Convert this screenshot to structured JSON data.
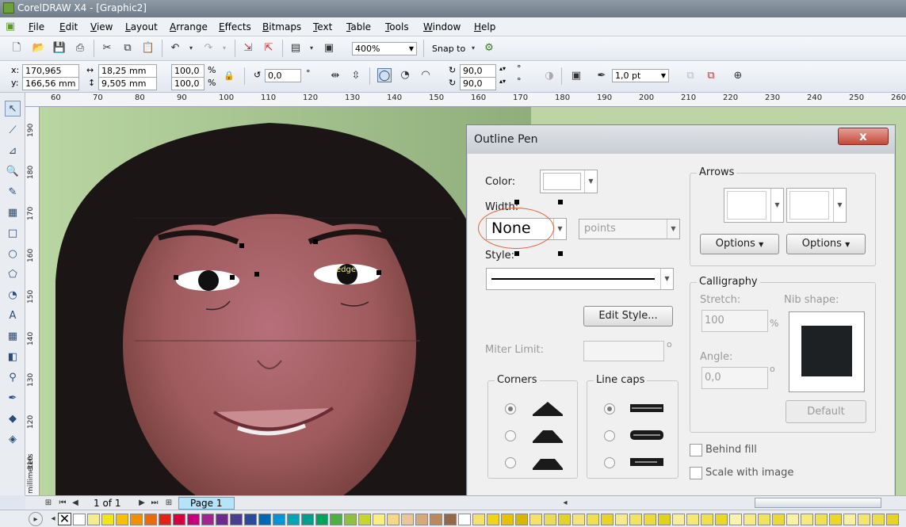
{
  "window": {
    "title": "CorelDRAW X4 - [Graphic2]"
  },
  "menu": [
    {
      "label": "File",
      "key": "F",
      "rest": "ile"
    },
    {
      "label": "Edit",
      "key": "E",
      "rest": "dit"
    },
    {
      "label": "View",
      "key": "V",
      "rest": "iew"
    },
    {
      "label": "Layout",
      "key": "L",
      "rest": "ayout"
    },
    {
      "label": "Arrange",
      "key": "A",
      "rest": "rrange"
    },
    {
      "label": "Effects",
      "key": "E",
      "rest": "ffects"
    },
    {
      "label": "Bitmaps",
      "key": "B",
      "rest": "itmaps"
    },
    {
      "label": "Text",
      "key": "T",
      "rest": "ext"
    },
    {
      "label": "Table",
      "key": "T",
      "rest": "able"
    },
    {
      "label": "Tools",
      "key": "T",
      "rest": "ools"
    },
    {
      "label": "Window",
      "key": "W",
      "rest": "indow"
    },
    {
      "label": "Help",
      "key": "H",
      "rest": "elp"
    }
  ],
  "toolbar": {
    "zoom": "400%",
    "snap_to": "Snap to"
  },
  "property_bar": {
    "x_label": "x:",
    "x": "170,965 mm",
    "y_label": "y:",
    "y": "166,56 mm",
    "width": "18,25 mm",
    "height": "9,505 mm",
    "scale_x": "100,0",
    "scale_y": "100,0",
    "percent": "%",
    "rotation": "0,0",
    "degree": "°",
    "skew_x": "90,0",
    "skew_y": "90,0",
    "outline_width": "1,0 pt"
  },
  "ruler": {
    "h_ticks": [
      "60",
      "70",
      "80",
      "90",
      "100",
      "110",
      "120",
      "130",
      "140",
      "150",
      "160",
      "170",
      "180",
      "190",
      "200",
      "210",
      "220",
      "230",
      "240",
      "250",
      "260"
    ],
    "v_ticks": [
      "190",
      "180",
      "170",
      "160",
      "150",
      "140",
      "130",
      "120",
      "110"
    ],
    "unit": "millimeters"
  },
  "canvas": {
    "label": "edge"
  },
  "status": {
    "page_count": "1 of 1",
    "page_tab": "Page 1"
  },
  "dialog": {
    "title": "Outline Pen",
    "close": "x",
    "color_label": "Color:",
    "width_label": "Width:",
    "width_value": "None",
    "units_value": "points",
    "style_label": "Style:",
    "edit_style": "Edit Style...",
    "miter_label": "Miter Limit:",
    "miter_deg": "o",
    "corners_title": "Corners",
    "linecaps_title": "Line caps",
    "arrows_title": "Arrows",
    "options_left": "Options",
    "options_right": "Options",
    "calligraphy_title": "Calligraphy",
    "stretch_label": "Stretch:",
    "stretch_value": "100",
    "stretch_unit": "%",
    "nib_label": "Nib shape:",
    "angle_label": "Angle:",
    "angle_value": "0,0",
    "angle_deg": "o",
    "default_button": "Default",
    "behind_fill": "Behind fill",
    "scale_with_image": "Scale with image"
  },
  "palette_colors": [
    "#ffffff",
    "#f4ee8a",
    "#f1e51d",
    "#f6c100",
    "#f29100",
    "#ea6a0c",
    "#e2231a",
    "#d7003f",
    "#c4007a",
    "#a1268c",
    "#6f2a8e",
    "#4c3c92",
    "#2c4a9b",
    "#0068b4",
    "#0095d8",
    "#00a6b8",
    "#009e8f",
    "#00a35a",
    "#4cae43",
    "#8fc040",
    "#c8d52e",
    "#fbf07e",
    "#f5d982",
    "#e9c79a",
    "#d6a97a",
    "#b98a5d",
    "#94694a",
    "#ffffff",
    "#f6e26b",
    "#f1d31a",
    "#e5c300",
    "#d9b600",
    "#f6e26b",
    "#eadc55",
    "#e0d32e",
    "#f4e47a",
    "#f0df4f",
    "#e8d429",
    "#f6ea8a",
    "#f2e462",
    "#ecdb39",
    "#e3d21c",
    "#f7ee99",
    "#f4e974",
    "#efe14c",
    "#e8d827",
    "#faf3b0",
    "#f6ec86",
    "#f1e35e",
    "#ebda36",
    "#f9f1a4",
    "#f5ea7b",
    "#f0e153",
    "#e9d72c",
    "#f8f0a0",
    "#f3e670",
    "#eedd48",
    "#e6d325"
  ]
}
